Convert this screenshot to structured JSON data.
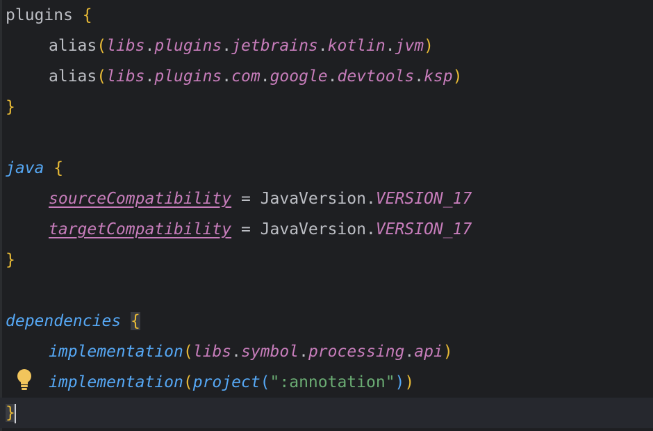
{
  "editor": {
    "lines": {
      "l1": {
        "kw": "plugins",
        "brace": "{"
      },
      "l2": {
        "fn": "alias",
        "open": "(",
        "p1": "libs",
        "d1": ".",
        "p2": "plugins",
        "d2": ".",
        "p3": "jetbrains",
        "d3": ".",
        "p4": "kotlin",
        "d4": ".",
        "p5": "jvm",
        "close": ")"
      },
      "l3": {
        "fn": "alias",
        "open": "(",
        "p1": "libs",
        "d1": ".",
        "p2": "plugins",
        "d2": ".",
        "p3": "com",
        "d3": ".",
        "p4": "google",
        "d4": ".",
        "p5": "devtools",
        "d5": ".",
        "p6": "ksp",
        "close": ")"
      },
      "l4": {
        "brace": "}"
      },
      "l6": {
        "kw": "java",
        "brace": "{"
      },
      "l7": {
        "prop": "sourceCompatibility",
        "eq": " = ",
        "cls": "JavaVersion",
        "dot": ".",
        "val": "VERSION_17"
      },
      "l8": {
        "prop": "targetCompatibility",
        "eq": " = ",
        "cls": "JavaVersion",
        "dot": ".",
        "val": "VERSION_17"
      },
      "l9": {
        "brace": "}"
      },
      "l11": {
        "kw": "dependencies",
        "brace": "{"
      },
      "l12": {
        "fn": "implementation",
        "open": "(",
        "p1": "libs",
        "d1": ".",
        "p2": "symbol",
        "d2": ".",
        "p3": "processing",
        "d3": ".",
        "p4": "api",
        "close": ")"
      },
      "l13": {
        "fn": "implementation",
        "open": "(",
        "fn2": "project",
        "open2": "(",
        "str": "\":annotation\"",
        "close2": ")",
        "close": ")"
      },
      "l14": {
        "brace": "}"
      }
    },
    "colors": {
      "background": "#1e1f22",
      "keyword": "#56a8f5",
      "property": "#c77dbb",
      "brace": "#e8ba36",
      "string": "#6aab73",
      "text": "#bcbec4"
    },
    "gutter_icon": "lightbulb-icon"
  }
}
